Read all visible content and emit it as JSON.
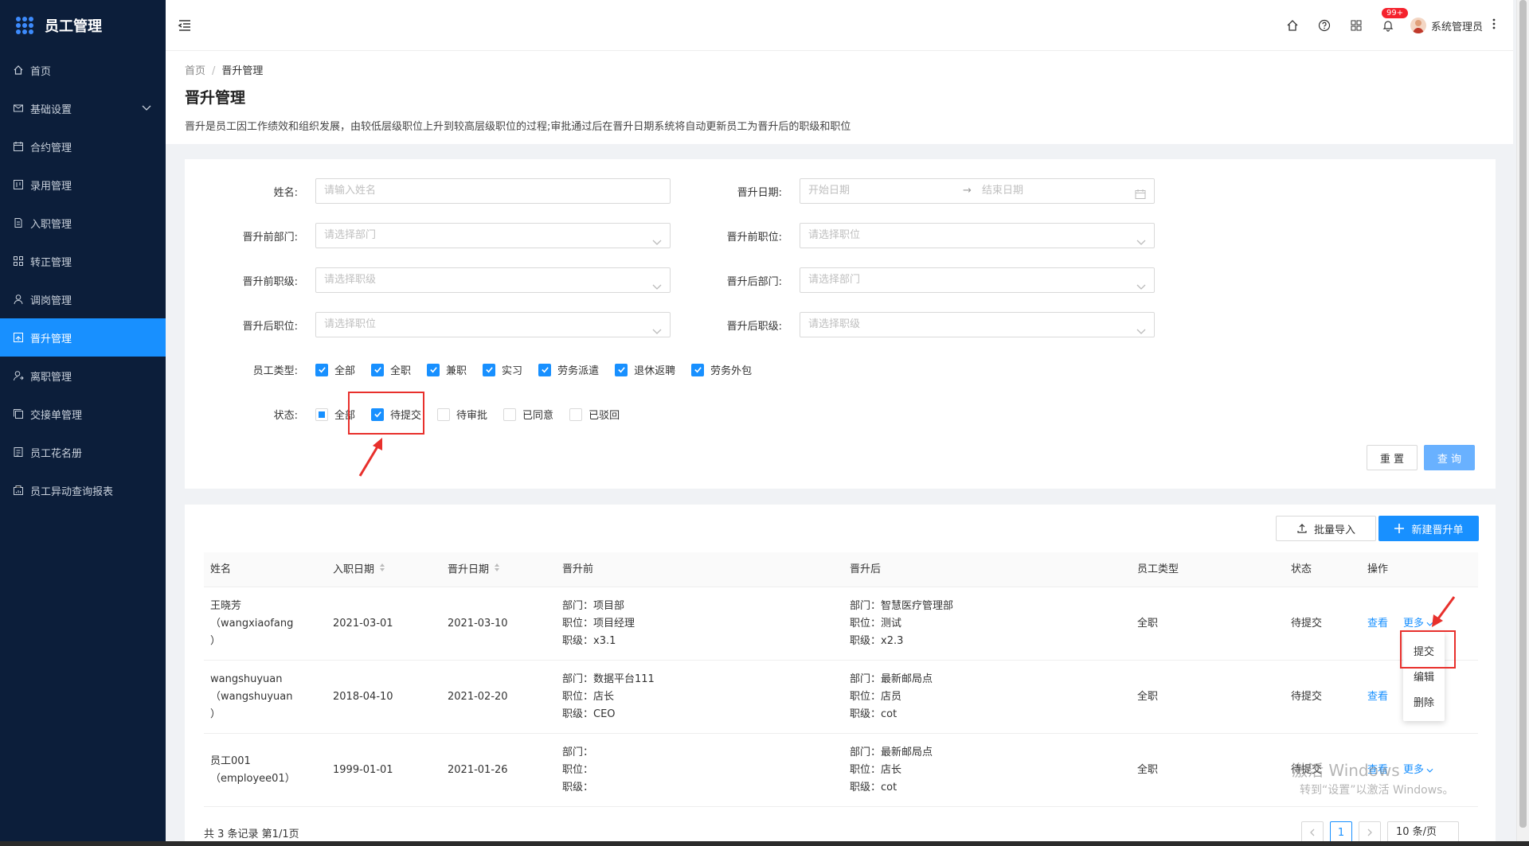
{
  "app": {
    "title": "员工管理"
  },
  "sidebar": {
    "items": [
      {
        "label": "首页",
        "icon": "home-icon"
      },
      {
        "label": "基础设置",
        "icon": "mail-icon"
      },
      {
        "label": "合约管理",
        "icon": "calendar-icon"
      },
      {
        "label": "录用管理",
        "icon": "board-icon"
      },
      {
        "label": "入职管理",
        "icon": "document-icon"
      },
      {
        "label": "转正管理",
        "icon": "grid-icon"
      },
      {
        "label": "调岗管理",
        "icon": "user-icon"
      },
      {
        "label": "晋升管理",
        "icon": "promotion-icon"
      },
      {
        "label": "离职管理",
        "icon": "user-leave-icon"
      },
      {
        "label": "交接单管理",
        "icon": "copy-icon"
      },
      {
        "label": "员工花名册",
        "icon": "roster-icon"
      },
      {
        "label": "员工异动查询报表",
        "icon": "report-icon"
      }
    ],
    "active_index": 7
  },
  "header": {
    "badge": "99+",
    "user_name": "系统管理员"
  },
  "breadcrumb": {
    "home": "首页",
    "sep": "/",
    "current": "晋升管理"
  },
  "page": {
    "title": "晋升管理",
    "description": "晋升是员工因工作绩效和组织发展，由较低层级职位上升到较高层级职位的过程;审批通过后在晋升日期系统将自动更新员工为晋升后的职级和职位"
  },
  "filters": {
    "name": {
      "label": "姓名:",
      "placeholder": "请输入姓名"
    },
    "promotion_date": {
      "label": "晋升日期:",
      "start_placeholder": "开始日期",
      "arrow": "→",
      "end_placeholder": "结束日期"
    },
    "dept_before": {
      "label": "晋升前部门:",
      "placeholder": "请选择部门"
    },
    "position_before": {
      "label": "晋升前职位:",
      "placeholder": "请选择职位"
    },
    "level_before": {
      "label": "晋升前职级:",
      "placeholder": "请选择职级"
    },
    "dept_after": {
      "label": "晋升后部门:",
      "placeholder": "请选择部门"
    },
    "position_after": {
      "label": "晋升后职位:",
      "placeholder": "请选择职位"
    },
    "level_after": {
      "label": "晋升后职级:",
      "placeholder": "请选择职级"
    },
    "employee_type": {
      "label": "员工类型:",
      "options": [
        {
          "label": "全部",
          "checked": true
        },
        {
          "label": "全职",
          "checked": true
        },
        {
          "label": "兼职",
          "checked": true
        },
        {
          "label": "实习",
          "checked": true
        },
        {
          "label": "劳务派遣",
          "checked": true
        },
        {
          "label": "退休返聘",
          "checked": true
        },
        {
          "label": "劳务外包",
          "checked": true
        }
      ]
    },
    "status": {
      "label": "状态:",
      "options": [
        {
          "label": "全部",
          "state": "partial"
        },
        {
          "label": "待提交",
          "state": "checked"
        },
        {
          "label": "待审批",
          "state": "unchecked"
        },
        {
          "label": "已同意",
          "state": "unchecked"
        },
        {
          "label": "已驳回",
          "state": "unchecked"
        }
      ]
    },
    "reset_label": "重 置",
    "search_label": "查 询"
  },
  "toolbar": {
    "import_label": "批量导入",
    "new_label": "新建晋升单"
  },
  "table": {
    "columns": [
      "姓名",
      "入职日期",
      "晋升日期",
      "晋升前",
      "晋升后",
      "员工类型",
      "状态",
      "操作"
    ],
    "rows": [
      {
        "name": "王晓芳",
        "login": "（wangxiaofang",
        "paren": "）",
        "hire_date": "2021-03-01",
        "promo_date": "2021-03-10",
        "before": [
          "部门：项目部",
          "职位：项目经理",
          "职级：x3.1"
        ],
        "after": [
          "部门：智慧医疗管理部",
          "职位：测试",
          "职级：x2.3"
        ],
        "type": "全职",
        "status": "待提交",
        "view": "查看",
        "more": "更多"
      },
      {
        "name": "wangshuyuan",
        "login": "（wangshuyuan",
        "paren": "）",
        "hire_date": "2018-04-10",
        "promo_date": "2021-02-20",
        "before": [
          "部门：数据平台111",
          "职位：店长",
          "职级：CEO"
        ],
        "after": [
          "部门：最新邮局点",
          "职位：店员",
          "职级：cot"
        ],
        "type": "全职",
        "status": "待提交",
        "view": "查看",
        "more": ""
      },
      {
        "name": "员工001",
        "login": "（employee01）",
        "paren": "",
        "hire_date": "1999-01-01",
        "promo_date": "2021-01-26",
        "before": [
          "部门：",
          "职位：",
          "职级："
        ],
        "after": [
          "部门：最新邮局点",
          "职位：店长",
          "职级：cot"
        ],
        "type": "全职",
        "status": "待提交",
        "view": "查看",
        "more": "更多"
      }
    ],
    "dropdown": [
      "提交",
      "编辑",
      "删除"
    ]
  },
  "footer": {
    "summary": "共 3 条记录 第1/1页",
    "current_page": "1",
    "page_size": "10 条/页"
  },
  "watermark": {
    "line1": "激活 Windows",
    "line2": "转到“设置”以激活 Windows。"
  },
  "colors": {
    "sidebar_bg": "#0c1e3a",
    "primary": "#1890ff",
    "highlight_red": "#e8302c"
  }
}
